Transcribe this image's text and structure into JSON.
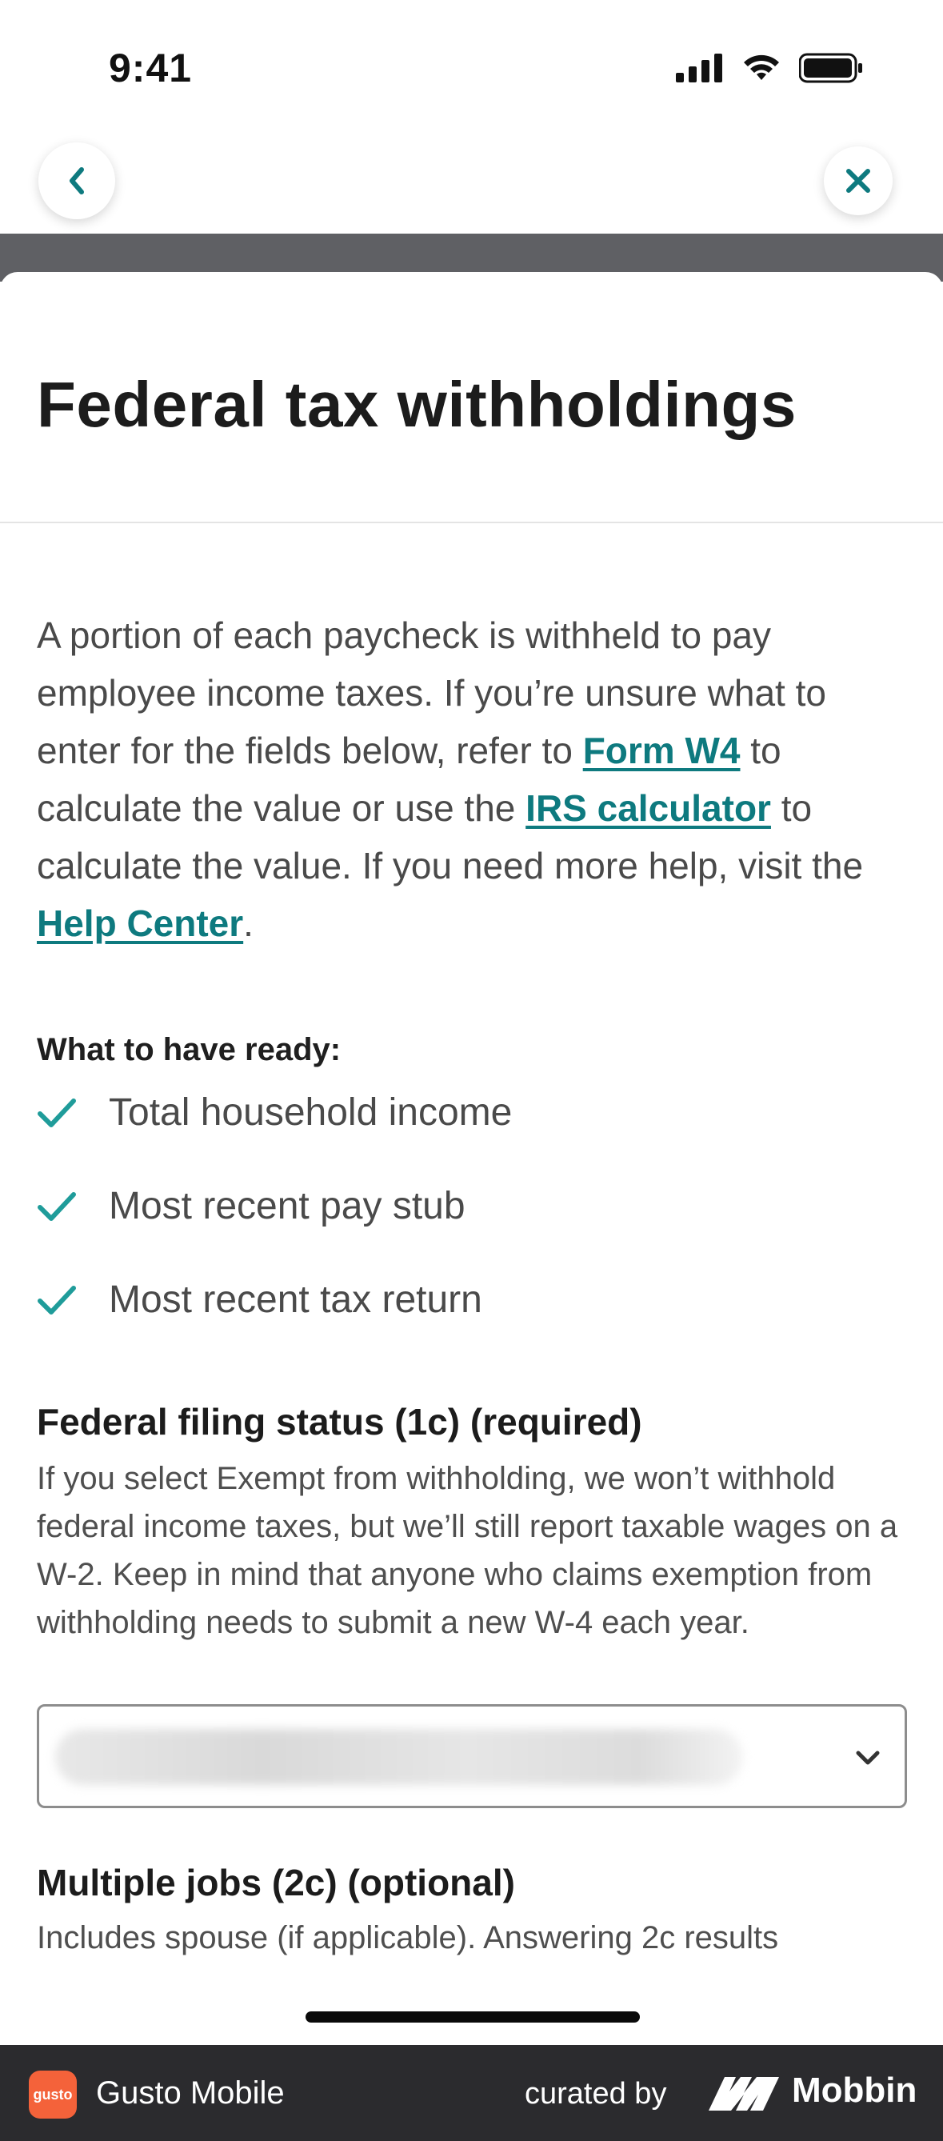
{
  "status_bar": {
    "time": "9:41"
  },
  "nav": {
    "back_icon": "chevron-left-icon",
    "close_icon": "close-icon",
    "accent_color": "#0e7a7f"
  },
  "sheet": {
    "title": "Federal tax withholdings",
    "intro": {
      "part1": "A portion of each paycheck is withheld to pay employee income taxes. If you’re unsure what to enter for the fields below, refer to ",
      "link_form_w4": "Form W4",
      "part2": " to calculate the value or use the ",
      "link_irs_calculator": "IRS calculator",
      "part3": " to calculate the value. If you need more help, visit the ",
      "link_help_center": "Help Center",
      "part4": "."
    },
    "ready": {
      "heading": "What to have ready:",
      "items": [
        {
          "label": "Total household income"
        },
        {
          "label": "Most recent pay stub"
        },
        {
          "label": "Most recent tax return"
        }
      ],
      "check_color": "#1f9c9a"
    },
    "filing_status": {
      "label": "Federal filing status (1c) (required)",
      "help": "If you select Exempt from withholding, we won’t withhold federal income taxes, but we’ll still report taxable wages on a W-2. Keep in mind that anyone who claims exemption from withholding needs to submit a new W-4 each year.",
      "selected_value": ""
    },
    "multiple_jobs": {
      "label": "Multiple jobs (2c) (optional)",
      "help": "Includes spouse (if applicable). Answering 2c results"
    }
  },
  "footer": {
    "app_logo_text": "gusto",
    "app_name": "Gusto Mobile",
    "curated_by": "curated by",
    "brand": "Mobbin"
  }
}
